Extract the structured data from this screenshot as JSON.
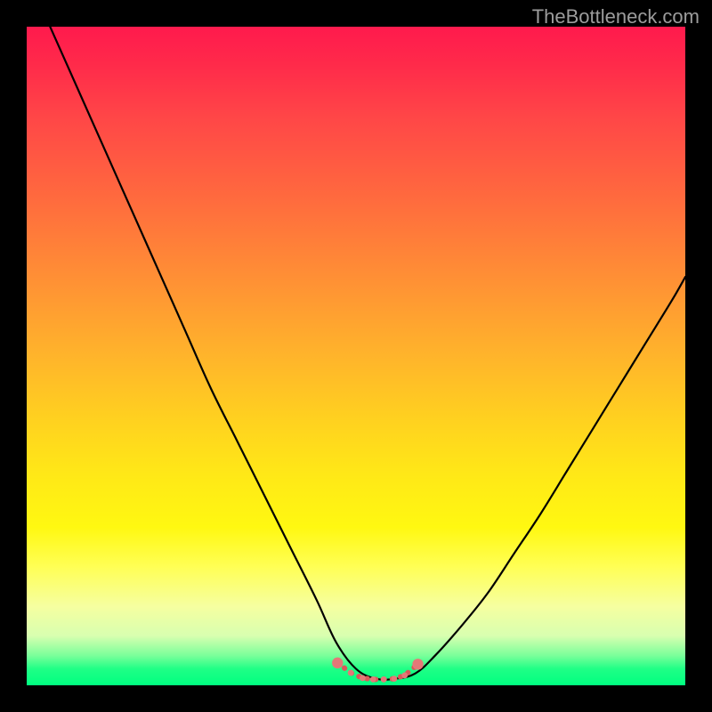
{
  "watermark": "TheBottleneck.com",
  "colors": {
    "background": "#000000",
    "gradient_top": "#ff1a4d",
    "gradient_bottom": "#00ff80",
    "curve_stroke": "#000000",
    "marker_stroke": "#d85a5a",
    "marker_fill": "#e57878"
  },
  "chart_data": {
    "type": "line",
    "title": "",
    "xlabel": "",
    "ylabel": "",
    "xlim": [
      0,
      100
    ],
    "ylim": [
      0,
      100
    ],
    "note": "Values estimated from pixel positions; y=0 is bottom (green), y=100 is top (red). Large V-shaped curve with flat minimum near x≈48–58 at y≈0.",
    "series": [
      {
        "name": "bottleneck-curve",
        "x": [
          0,
          4,
          8,
          12,
          16,
          20,
          24,
          28,
          32,
          36,
          40,
          44,
          47,
          50,
          53,
          56,
          59,
          62,
          66,
          70,
          74,
          78,
          82,
          86,
          90,
          94,
          98,
          100
        ],
        "y": [
          108,
          99,
          90,
          81,
          72,
          63,
          54,
          45,
          37,
          29,
          21,
          13,
          6.5,
          2.5,
          1,
          1,
          1.8,
          4.5,
          9,
          14,
          20,
          26,
          32.5,
          39,
          45.5,
          52,
          58.5,
          62
        ]
      }
    ],
    "markers": {
      "name": "highlight-region",
      "approx_x_range": [
        47,
        60
      ],
      "approx_y": 1.2,
      "dots_x": [
        47.2,
        49.2,
        51.0,
        52.6,
        54.2,
        55.8,
        57.4,
        59.4
      ],
      "dots_y": [
        3.4,
        1.9,
        1.1,
        0.9,
        0.9,
        1.0,
        1.5,
        3.2
      ]
    }
  }
}
